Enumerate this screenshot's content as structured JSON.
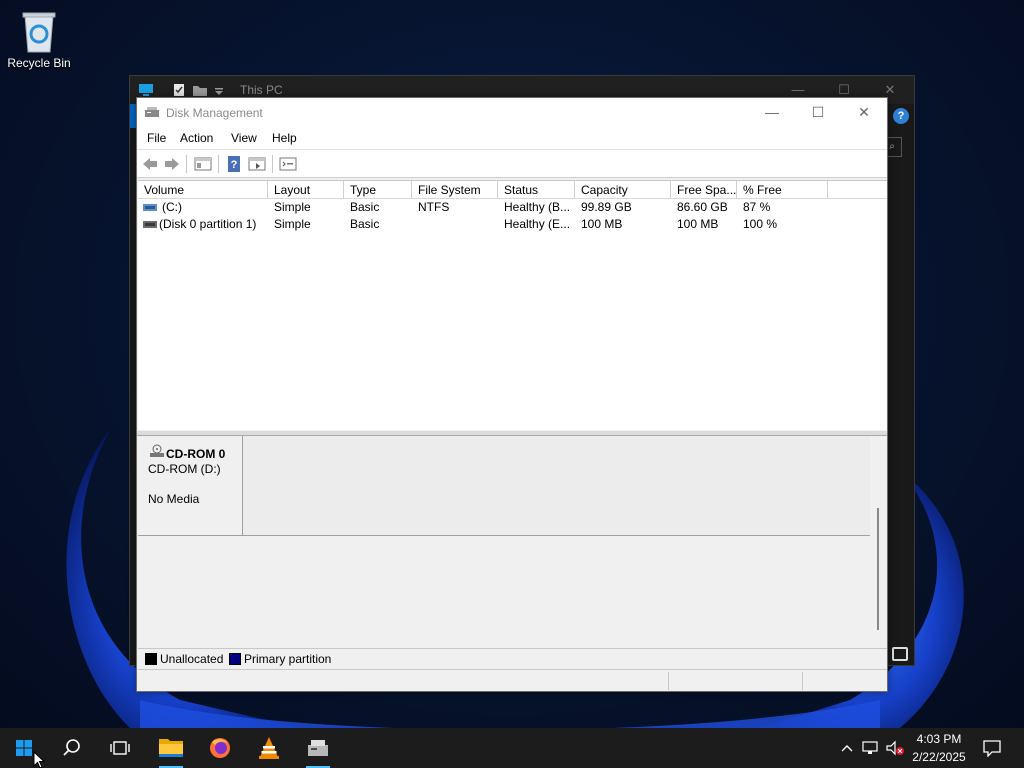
{
  "desktop": {
    "recycle_bin_label": "Recycle Bin"
  },
  "explorer": {
    "title": "This PC",
    "minimize": "—",
    "maximize": "☐",
    "close": "✕",
    "help": "?"
  },
  "window": {
    "title": "Disk Management",
    "minimize": "—",
    "maximize": "☐",
    "close": "✕"
  },
  "menu": {
    "file": "File",
    "action": "Action",
    "view": "View",
    "help": "Help"
  },
  "toolbar": {
    "icons": [
      "back-icon",
      "forward-icon",
      "show-hide-console-tree-icon",
      "help-icon",
      "properties-icon",
      "list-view-icon"
    ]
  },
  "table": {
    "columns": [
      "Volume",
      "Layout",
      "Type",
      "File System",
      "Status",
      "Capacity",
      "Free Spa...",
      "% Free"
    ],
    "rows": [
      {
        "volume": "(C:)",
        "layout": "Simple",
        "type": "Basic",
        "file_system": "NTFS",
        "status": "Healthy (B...",
        "capacity": "99.89 GB",
        "free_space": "86.60 GB",
        "pct_free": "87 %"
      },
      {
        "volume": "(Disk 0 partition 1)",
        "layout": "Simple",
        "type": "Basic",
        "file_system": "",
        "status": "Healthy (E...",
        "capacity": "100 MB",
        "free_space": "100 MB",
        "pct_free": "100 %"
      }
    ]
  },
  "disk": {
    "name": "CD-ROM 0",
    "type": "CD-ROM (D:)",
    "status": "No Media"
  },
  "legend": {
    "unallocated": "Unallocated",
    "primary": "Primary partition",
    "unallocated_color": "#000000",
    "primary_color": "#00007f"
  },
  "taskbar": {
    "time": "4:03 PM",
    "date": "2/22/2025",
    "icons": [
      "start-icon",
      "search-icon",
      "task-view-icon",
      "file-explorer-icon",
      "firefox-icon",
      "vlc-icon",
      "disk-management-icon"
    ]
  }
}
